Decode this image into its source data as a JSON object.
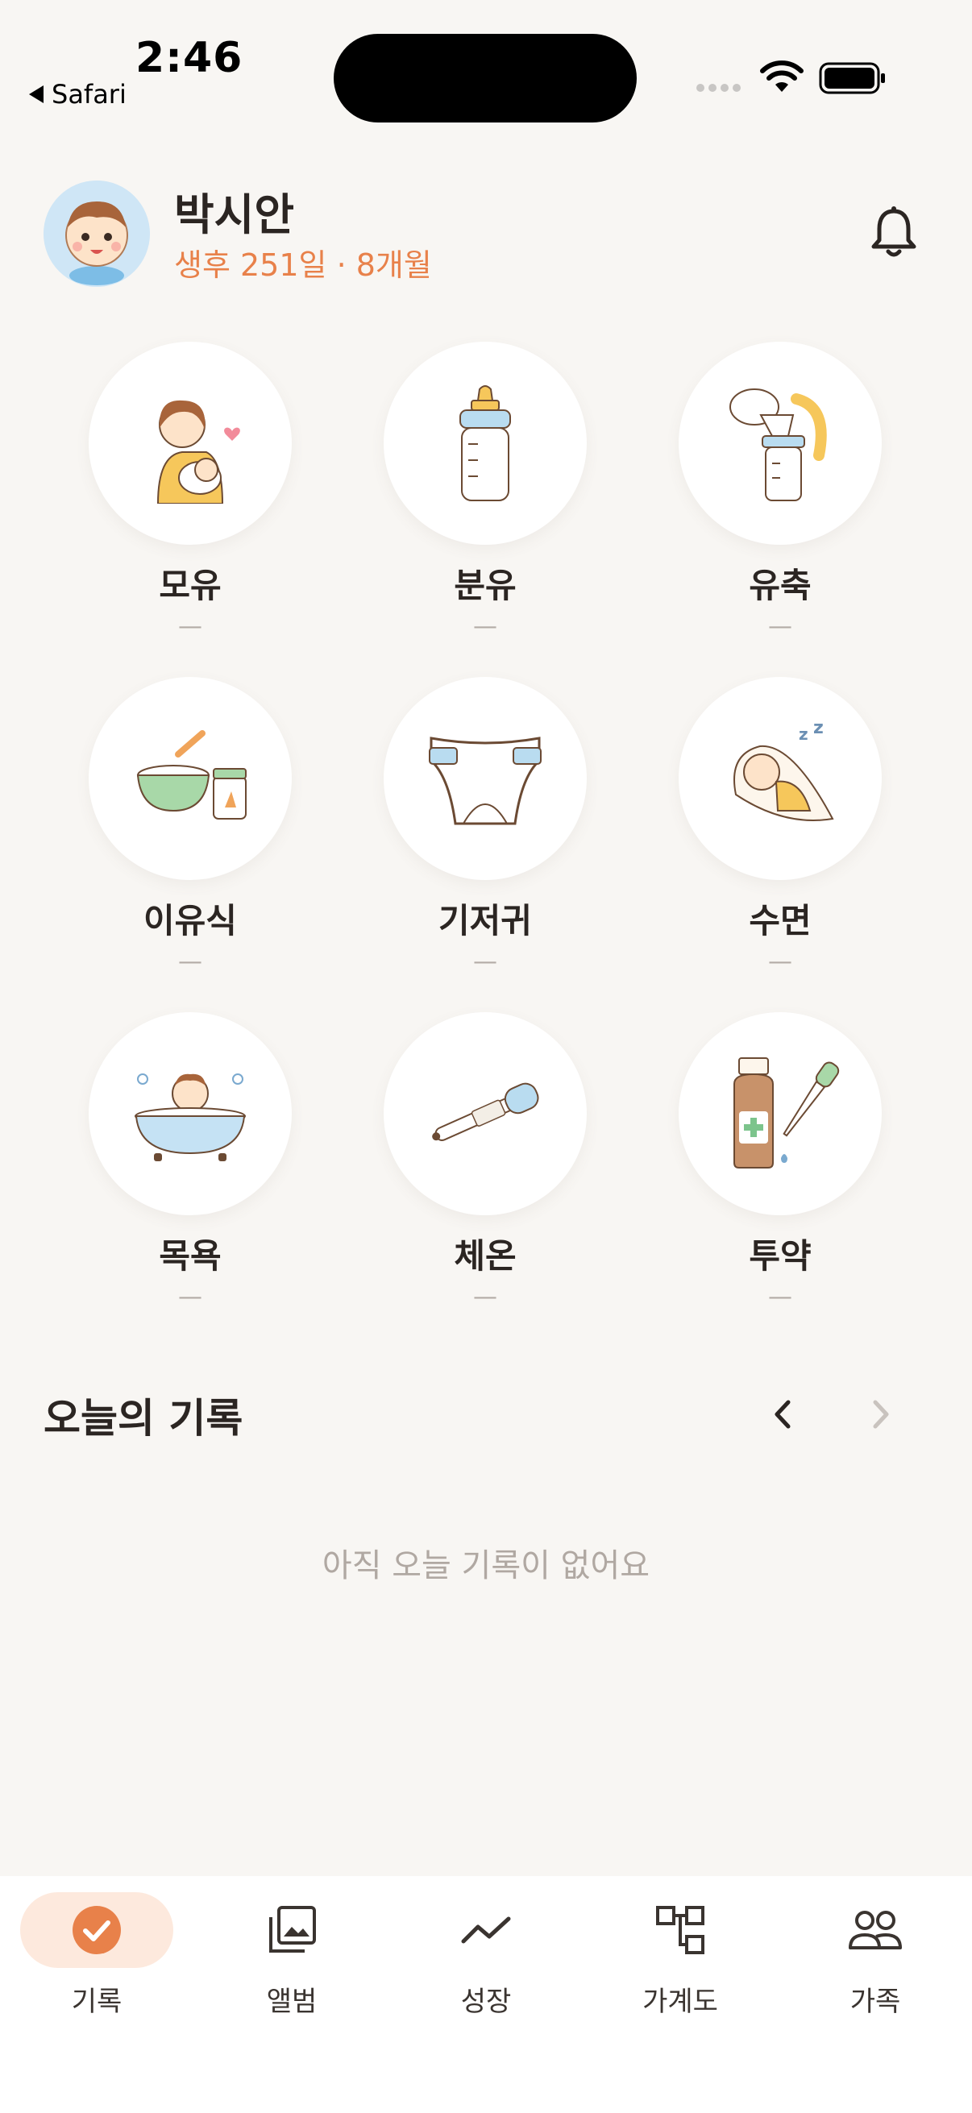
{
  "status_bar": {
    "time": "2:46",
    "back_label": "Safari"
  },
  "header": {
    "baby_name": "박시안",
    "age_text": "생후 251일 · 8개월"
  },
  "categories": [
    {
      "label": "모유",
      "value": "—",
      "icon": "breastfeeding-icon"
    },
    {
      "label": "분유",
      "value": "—",
      "icon": "baby-bottle-icon"
    },
    {
      "label": "유축",
      "value": "—",
      "icon": "breast-pump-icon"
    },
    {
      "label": "이유식",
      "value": "—",
      "icon": "baby-food-icon"
    },
    {
      "label": "기저귀",
      "value": "—",
      "icon": "diaper-icon"
    },
    {
      "label": "수면",
      "value": "—",
      "icon": "sleeping-baby-icon"
    },
    {
      "label": "목욕",
      "value": "—",
      "icon": "bath-icon"
    },
    {
      "label": "체온",
      "value": "—",
      "icon": "thermometer-icon"
    },
    {
      "label": "투약",
      "value": "—",
      "icon": "medicine-icon"
    }
  ],
  "today": {
    "title": "오늘의 기록",
    "empty_message": "아직 오늘 기록이 없어요"
  },
  "tabs": [
    {
      "label": "기록",
      "icon": "check-circle-icon",
      "active": true
    },
    {
      "label": "앨범",
      "icon": "album-icon",
      "active": false
    },
    {
      "label": "성장",
      "icon": "chart-line-icon",
      "active": false
    },
    {
      "label": "가계도",
      "icon": "family-tree-icon",
      "active": false
    },
    {
      "label": "가족",
      "icon": "people-icon",
      "active": false
    }
  ],
  "colors": {
    "accent": "#e8814a",
    "background": "#f8f6f3",
    "text": "#2b2522",
    "muted": "#b0a8a2"
  }
}
